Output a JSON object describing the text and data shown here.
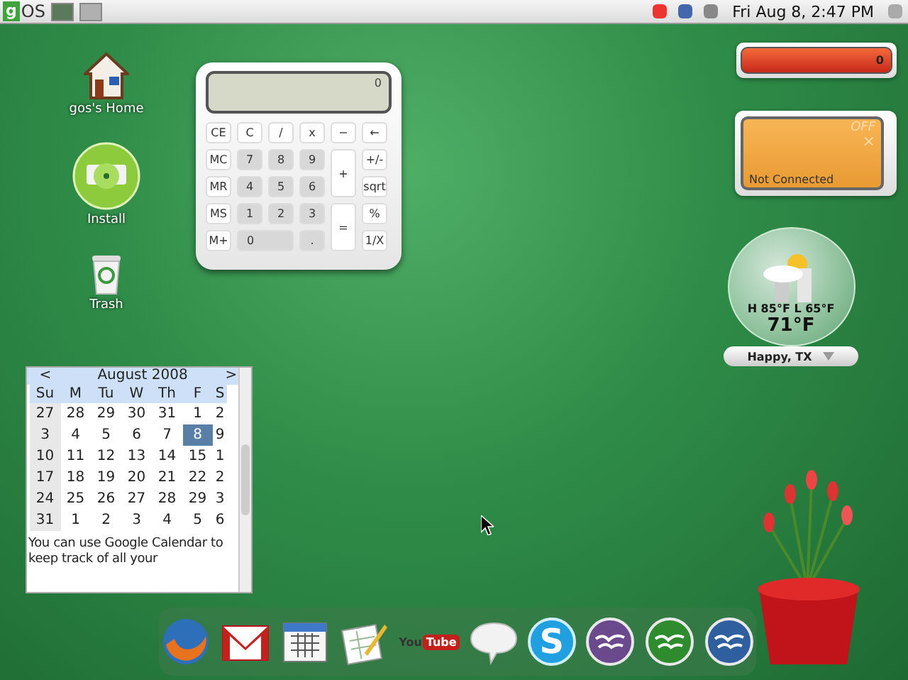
{
  "top_bar": {
    "logo": {
      "badge": "g",
      "text": "OS"
    },
    "workspaces": [
      {
        "selected": true
      },
      {
        "selected": false
      }
    ],
    "clock": "Fri Aug  8,  2:47 PM"
  },
  "desktop_icons": [
    {
      "kind": "home",
      "label": "gos's Home"
    },
    {
      "kind": "disc",
      "label": "Install"
    },
    {
      "kind": "trash",
      "label": "Trash"
    }
  ],
  "calculator": {
    "display": "0",
    "keys": [
      {
        "label": "CE",
        "kind": "function"
      },
      {
        "label": "C",
        "kind": "function"
      },
      {
        "label": "/",
        "kind": "function"
      },
      {
        "label": "x",
        "kind": "function"
      },
      {
        "label": "−",
        "kind": "function"
      },
      {
        "label": "←",
        "kind": "function"
      },
      {
        "label": "MC",
        "kind": "function"
      },
      {
        "label": "7",
        "kind": "digit"
      },
      {
        "label": "8",
        "kind": "digit"
      },
      {
        "label": "9",
        "kind": "digit"
      },
      {
        "label": "+",
        "kind": "tall"
      },
      {
        "label": "+/-",
        "kind": "function"
      },
      {
        "label": "MR",
        "kind": "function"
      },
      {
        "label": "4",
        "kind": "digit"
      },
      {
        "label": "5",
        "kind": "digit"
      },
      {
        "label": "6",
        "kind": "digit"
      },
      {
        "label": "sqrt",
        "kind": "function"
      },
      {
        "label": "MS",
        "kind": "function"
      },
      {
        "label": "1",
        "kind": "digit"
      },
      {
        "label": "2",
        "kind": "digit"
      },
      {
        "label": "3",
        "kind": "digit"
      },
      {
        "label": "=",
        "kind": "tall"
      },
      {
        "label": "%",
        "kind": "function"
      },
      {
        "label": "M+",
        "kind": "function"
      },
      {
        "label": "0",
        "kind": "wide"
      },
      {
        "label": ".",
        "kind": "digit"
      },
      {
        "label": "1/X",
        "kind": "function"
      }
    ]
  },
  "calendar": {
    "prev": "<",
    "month": "August 2008",
    "next": ">",
    "weekdays": [
      "Su",
      "M",
      "Tu",
      "W",
      "Th",
      "F",
      "S"
    ],
    "weeks": [
      [
        {
          "day": "27",
          "selected": false
        },
        {
          "day": "28",
          "selected": false
        },
        {
          "day": "29",
          "selected": false
        },
        {
          "day": "30",
          "selected": false
        },
        {
          "day": "31",
          "selected": false
        },
        {
          "day": "1",
          "selected": false
        },
        {
          "day": "2",
          "selected": false
        }
      ],
      [
        {
          "day": "3",
          "selected": false
        },
        {
          "day": "4",
          "selected": false
        },
        {
          "day": "5",
          "selected": false
        },
        {
          "day": "6",
          "selected": false
        },
        {
          "day": "7",
          "selected": false
        },
        {
          "day": "8",
          "selected": true
        },
        {
          "day": "9",
          "selected": false
        }
      ],
      [
        {
          "day": "10",
          "selected": false
        },
        {
          "day": "11",
          "selected": false
        },
        {
          "day": "12",
          "selected": false
        },
        {
          "day": "13",
          "selected": false
        },
        {
          "day": "14",
          "selected": false
        },
        {
          "day": "15",
          "selected": false
        },
        {
          "day": "1",
          "selected": false
        }
      ],
      [
        {
          "day": "17",
          "selected": false
        },
        {
          "day": "18",
          "selected": false
        },
        {
          "day": "19",
          "selected": false
        },
        {
          "day": "20",
          "selected": false
        },
        {
          "day": "21",
          "selected": false
        },
        {
          "day": "22",
          "selected": false
        },
        {
          "day": "2",
          "selected": false
        }
      ],
      [
        {
          "day": "24",
          "selected": false
        },
        {
          "day": "25",
          "selected": false
        },
        {
          "day": "26",
          "selected": false
        },
        {
          "day": "27",
          "selected": false
        },
        {
          "day": "28",
          "selected": false
        },
        {
          "day": "29",
          "selected": false
        },
        {
          "day": "3",
          "selected": false
        }
      ],
      [
        {
          "day": "31",
          "selected": false
        },
        {
          "day": "1",
          "selected": false
        },
        {
          "day": "2",
          "selected": false
        },
        {
          "day": "3",
          "selected": false
        },
        {
          "day": "4",
          "selected": false
        },
        {
          "day": "5",
          "selected": false
        },
        {
          "day": "6",
          "selected": false
        }
      ]
    ],
    "note": "You can use Google Calendar to keep track of all your"
  },
  "network_meter": {
    "reading": "0"
  },
  "wireless": {
    "state": "OFF",
    "close": "×",
    "status": "Not Connected"
  },
  "weather": {
    "high_low": "H 85°F L 65°F",
    "temperature": "71°F",
    "location": "Happy, TX"
  },
  "dock": [
    {
      "kind": "firefox"
    },
    {
      "kind": "mail"
    },
    {
      "kind": "calendar"
    },
    {
      "kind": "spreadsheet"
    },
    {
      "kind": "video",
      "text": [
        "You",
        "Tube"
      ]
    },
    {
      "kind": "chat"
    },
    {
      "kind": "phone",
      "text": "S"
    },
    {
      "kind": "office",
      "color": "#6a4a8c"
    },
    {
      "kind": "office",
      "color": "#2e8b2e"
    },
    {
      "kind": "office",
      "color": "#2f5f9f"
    }
  ]
}
